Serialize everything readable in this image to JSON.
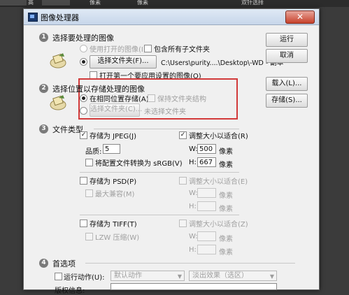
{
  "host_toolbar": {
    "left_label": "高",
    "btn_a": "像素",
    "btn_b": "像素",
    "right_label": "双针选择"
  },
  "dialog": {
    "title": "图像处理器",
    "close_label": "✕",
    "section1": {
      "number": "1",
      "title": "选择要处理的图像",
      "use_open_label": "使用打开的图像(I)",
      "include_subfolders_label": "包含所有子文件夹",
      "select_folder_button": "选择文件夹(F)...",
      "folder_path": "C:\\Users\\purity....\\Desktop\\-WD - 副本",
      "open_first_label": "打开第一个要应用设置的图像(O)"
    },
    "section2": {
      "number": "2",
      "title": "选择位置以存储处理的图像",
      "same_location_label": "在相同位置存储(A)",
      "keep_structure_label": "保持文件夹结构",
      "select_folder_button": "选择文件夹(C)...",
      "no_folder_text": "未选择文件夹"
    },
    "section3": {
      "number": "3",
      "title": "文件类型",
      "jpeg": {
        "save_label": "存储为 JPEG(J)",
        "resize_label": "调整大小以适合(R)",
        "quality_label": "品质:",
        "quality_value": "5",
        "convert_label": "将配置文件转换为 sRGB(V)",
        "w_label": "W:",
        "w_value": "500",
        "w_unit": "像素",
        "h_label": "H:",
        "h_value": "667",
        "h_unit": "像素"
      },
      "psd": {
        "save_label": "存储为 PSD(P)",
        "resize_label": "调整大小以适合(E)",
        "max_compat_label": "最大兼容(M)",
        "w_label": "W:",
        "w_unit": "像素",
        "h_label": "H:",
        "h_unit": "像素"
      },
      "tiff": {
        "save_label": "存储为 TIFF(T)",
        "resize_label": "调整大小以适合(Z)",
        "lzw_label": "LZW 压缩(W)",
        "w_label": "W:",
        "w_unit": "像素",
        "h_label": "H:",
        "h_unit": "像素"
      }
    },
    "section4": {
      "number": "4",
      "title": "首选项",
      "run_action_label": "运行动作(U):",
      "action_set_value": "默认动作",
      "action_value": "淡出效果（选区）",
      "copyright_label": "版权信息:"
    },
    "buttons": {
      "run": "运行",
      "cancel": "取消",
      "load": "载入(L)...",
      "save": "存储(S)..."
    }
  },
  "colors": {
    "highlight_box": "#d23a3a",
    "dialog_bg": "#f0f0f0"
  }
}
